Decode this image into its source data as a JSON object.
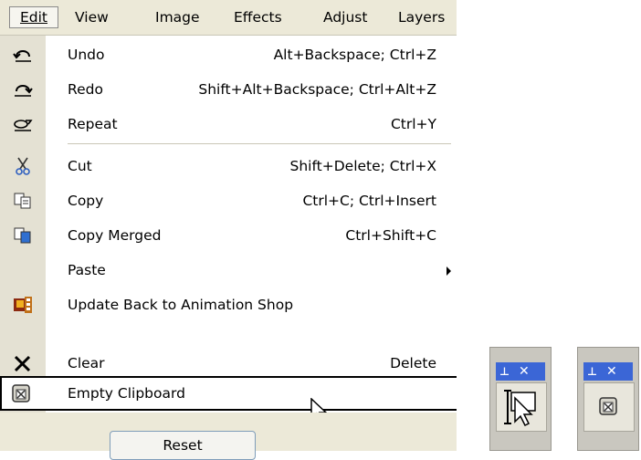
{
  "menubar": {
    "items": [
      {
        "label": "Edit"
      },
      {
        "label": "View"
      },
      {
        "label": "Image"
      },
      {
        "label": "Effects"
      },
      {
        "label": "Adjust"
      },
      {
        "label": "Layers"
      }
    ]
  },
  "menu": {
    "items": [
      {
        "label": "Undo",
        "shortcut": "Alt+Backspace; Ctrl+Z",
        "icon": "undo-icon"
      },
      {
        "label": "Redo",
        "shortcut": "Shift+Alt+Backspace; Ctrl+Alt+Z",
        "icon": "redo-icon"
      },
      {
        "label": "Repeat",
        "shortcut": "Ctrl+Y",
        "icon": "repeat-icon"
      },
      {
        "label": "Cut",
        "shortcut": "Shift+Delete; Ctrl+X",
        "icon": "scissors-icon"
      },
      {
        "label": "Copy",
        "shortcut": "Ctrl+C; Ctrl+Insert",
        "icon": "copy-icon"
      },
      {
        "label": "Copy Merged",
        "shortcut": "Ctrl+Shift+C",
        "icon": "copy-merged-icon"
      },
      {
        "label": "Paste",
        "shortcut": "",
        "icon": ""
      },
      {
        "label": "Update Back to Animation Shop",
        "shortcut": "",
        "icon": "animation-shop-icon"
      },
      {
        "label": "Clear",
        "shortcut": "Delete",
        "icon": "clear-x-icon"
      },
      {
        "label": "Empty Clipboard",
        "shortcut": "",
        "icon": "empty-clipboard-icon"
      }
    ]
  },
  "bottom": {
    "button_label": "Reset"
  },
  "colors": {
    "menubar_bg": "#ece9d8",
    "panel_title": "#3b66d6"
  }
}
